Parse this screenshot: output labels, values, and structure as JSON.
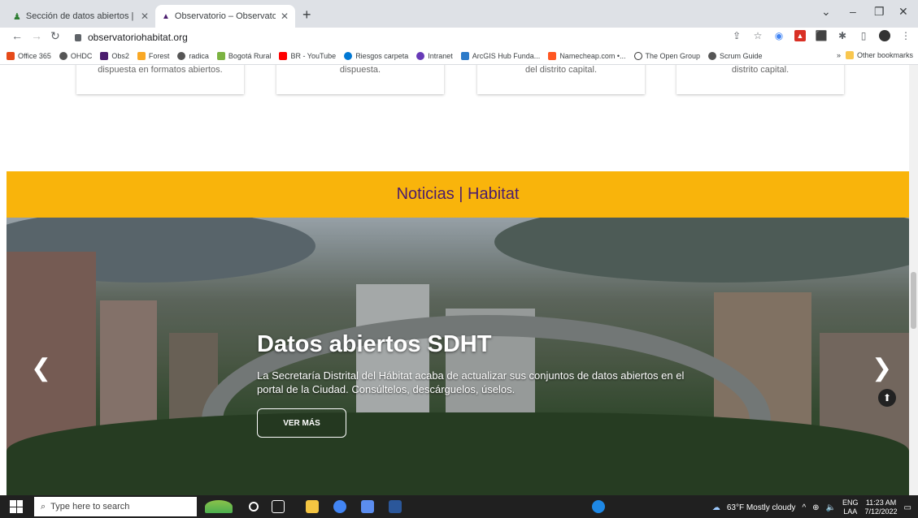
{
  "browser": {
    "tabs": [
      {
        "title": "Sección de datos abiertos | Secre",
        "active": false
      },
      {
        "title": "Observatorio – Observatorio de",
        "active": true
      }
    ],
    "url": "observatoriohabitat.org",
    "bookmarks": [
      "Office 365",
      "OHDC",
      "Obs2",
      "Forest",
      "radica",
      "Bogotá Rural",
      "BR - YouTube",
      "Riesgos carpeta",
      "Intranet",
      "ArcGIS Hub Funda...",
      "Namecheap.com •...",
      "The Open Group",
      "Scrum Guide"
    ],
    "bookmarks_overflow": "»",
    "other_bookmarks": "Other bookmarks"
  },
  "page": {
    "cards": [
      "dispuesta en formatos abiertos.",
      "dispuesta.",
      "del distrito capital.",
      "distrito capital."
    ],
    "news_heading": "Noticias | Habitat",
    "slide": {
      "title": "Datos abiertos SDHT",
      "description": "La Secretaría Distrital del Hábitat acaba de actualizar sus conjuntos de datos abiertos en el portal de la Ciudad. Consúltelos, descárguelos, úselos.",
      "button": "VER MÁS"
    }
  },
  "taskbar": {
    "search_placeholder": "Type here to search",
    "weather": "63°F  Mostly cloudy",
    "lang": "ENG",
    "lang2": "LAA",
    "time": "11:23 AM",
    "date": "7/12/2022"
  },
  "colors": {
    "accent": "#f9b40b",
    "heading": "#4b1d6e"
  }
}
